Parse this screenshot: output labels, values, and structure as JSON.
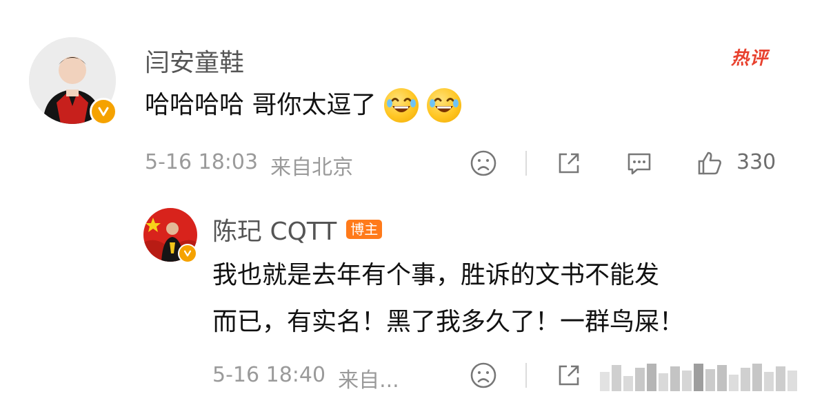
{
  "comment": {
    "username": "闫安童鞋",
    "badge": "热评",
    "text": "哈哈哈哈 哥你太逗了",
    "emojis": [
      "laugh-cry-emoji",
      "laugh-cry-emoji"
    ],
    "time": "5-16 18:03",
    "location": "来自北京",
    "like_count": "330"
  },
  "reply": {
    "username": "陈玘 CQTT",
    "badge": "博主",
    "text_line1": "我也就是去年有个事，胜诉的文书不能发",
    "text_line2": "而已，有实名！黑了我多久了！一群鸟屎！",
    "time": "5-16 18:40",
    "location": "来自..."
  },
  "colors": {
    "accent_orange": "#ff7a1a",
    "verify_gold": "#f5a200",
    "hot_red": "#e8412e",
    "meta_gray": "#9a9a9a"
  }
}
